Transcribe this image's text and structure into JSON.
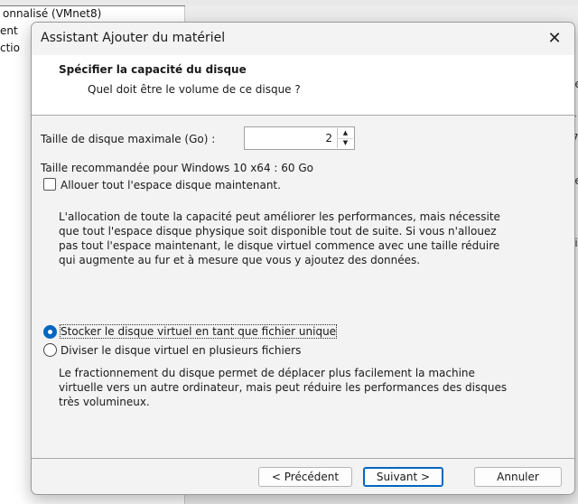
{
  "background": {
    "left_fragments": [
      "onnalisé (VMnet8)",
      "ent",
      "ctio"
    ],
    "right_fragments": [
      "le",
      "r",
      "7",
      "le",
      "li"
    ]
  },
  "dialog": {
    "title": "Assistant Ajouter du matériel",
    "close_glyph": "✕",
    "header": {
      "title": "Spécifier la capacité du disque",
      "subtitle": "Quel doit être le volume de ce disque ?"
    },
    "size_label": "Taille de disque maximale (Go) :",
    "size_value": "2",
    "recommended": "Taille recommandée pour Windows 10 x64 : 60 Go",
    "allocate_label": "Allouer tout l'espace disque maintenant.",
    "allocate_checked": false,
    "allocate_description": [
      "L'allocation de toute la capacité peut améliorer les performances, mais nécessite",
      "que tout l'espace disque physique soit disponible tout de suite. Si vous n'allouez",
      "pas tout l'espace maintenant, le disque virtuel commence avec une taille réduire",
      "qui augmente au fur et à mesure que vous y ajoutez des données."
    ],
    "options": [
      {
        "label": "Stocker le disque virtuel en tant que fichier unique",
        "selected": true
      },
      {
        "label": "Diviser le disque virtuel en plusieurs fichiers",
        "selected": false
      }
    ],
    "split_description": [
      "Le fractionnement du disque permet de déplacer plus facilement la machine",
      "virtuelle vers un autre ordinateur, mais peut réduire les performances des disques",
      "très volumineux."
    ],
    "buttons": {
      "back": "< Précédent",
      "next": "Suivant >",
      "cancel": "Annuler"
    }
  }
}
